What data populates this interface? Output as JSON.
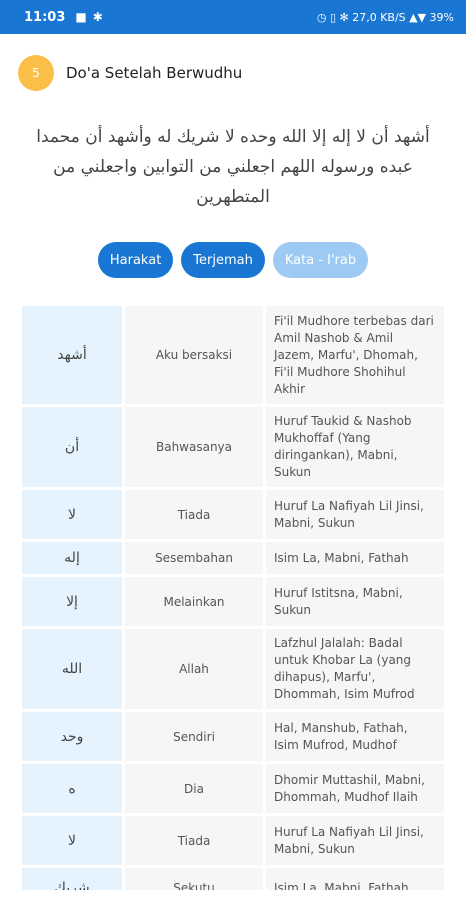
{
  "status": {
    "time": "11:03",
    "right": "◷ ▯ ✻ 27,0 KB/S ▲▼ 39%"
  },
  "header": {
    "badge": "5",
    "title": "Do'a Setelah Berwudhu"
  },
  "arabic_text": "أشهد أن لا إله إلا الله وحده لا شريك له وأشهد أن محمدا عبده ورسوله اللهم اجعلني من التوابين واجعلني من المتطهرين",
  "buttons": [
    "Harakat",
    "Terjemah",
    "Kata - I'rab"
  ],
  "rows": [
    {
      "ar": "أشهد",
      "id": "Aku bersaksi",
      "irab": "Fi'il Mudhore terbebas dari Amil Nashob & Amil Jazem, Marfu', Dhomah, Fi'il Mudhore Shohihul Akhir",
      "h": 98
    },
    {
      "ar": "أن",
      "id": "Bahwasanya",
      "irab": "Huruf Taukid & Nashob Mukhoffaf (Yang diringankan), Mabni, Sukun",
      "h": 80
    },
    {
      "ar": "لا",
      "id": "Tiada",
      "irab": "Huruf La Nafiyah Lil Jinsi, Mabni, Sukun",
      "h": 49
    },
    {
      "ar": "إله",
      "id": "Sesembahan",
      "irab": "Isim La, Mabni, Fathah",
      "h": 32
    },
    {
      "ar": "إلا",
      "id": "Melainkan",
      "irab": "Huruf Istitsna, Mabni, Sukun",
      "h": 49
    },
    {
      "ar": "الله",
      "id": "Allah",
      "irab": "Lafzhul Jalalah: Badal untuk Khobar La (yang dihapus), Marfu', Dhommah, Isim Mufrod",
      "h": 80
    },
    {
      "ar": "وحد",
      "id": "Sendiri",
      "irab": "Hal, Manshub, Fathah, Isim Mufrod, Mudhof",
      "h": 49
    },
    {
      "ar": "ه",
      "id": "Dia",
      "irab": "Dhomir Muttashil, Mabni, Dhommah, Mudhof Ilaih",
      "h": 49
    },
    {
      "ar": "لا",
      "id": "Tiada",
      "irab": "Huruf La Nafiyah Lil Jinsi, Mabni, Sukun",
      "h": 49
    },
    {
      "ar": "شريك",
      "id": "Sekutu",
      "irab": "Isim La, Mabni, Fathah",
      "h": 40
    }
  ]
}
